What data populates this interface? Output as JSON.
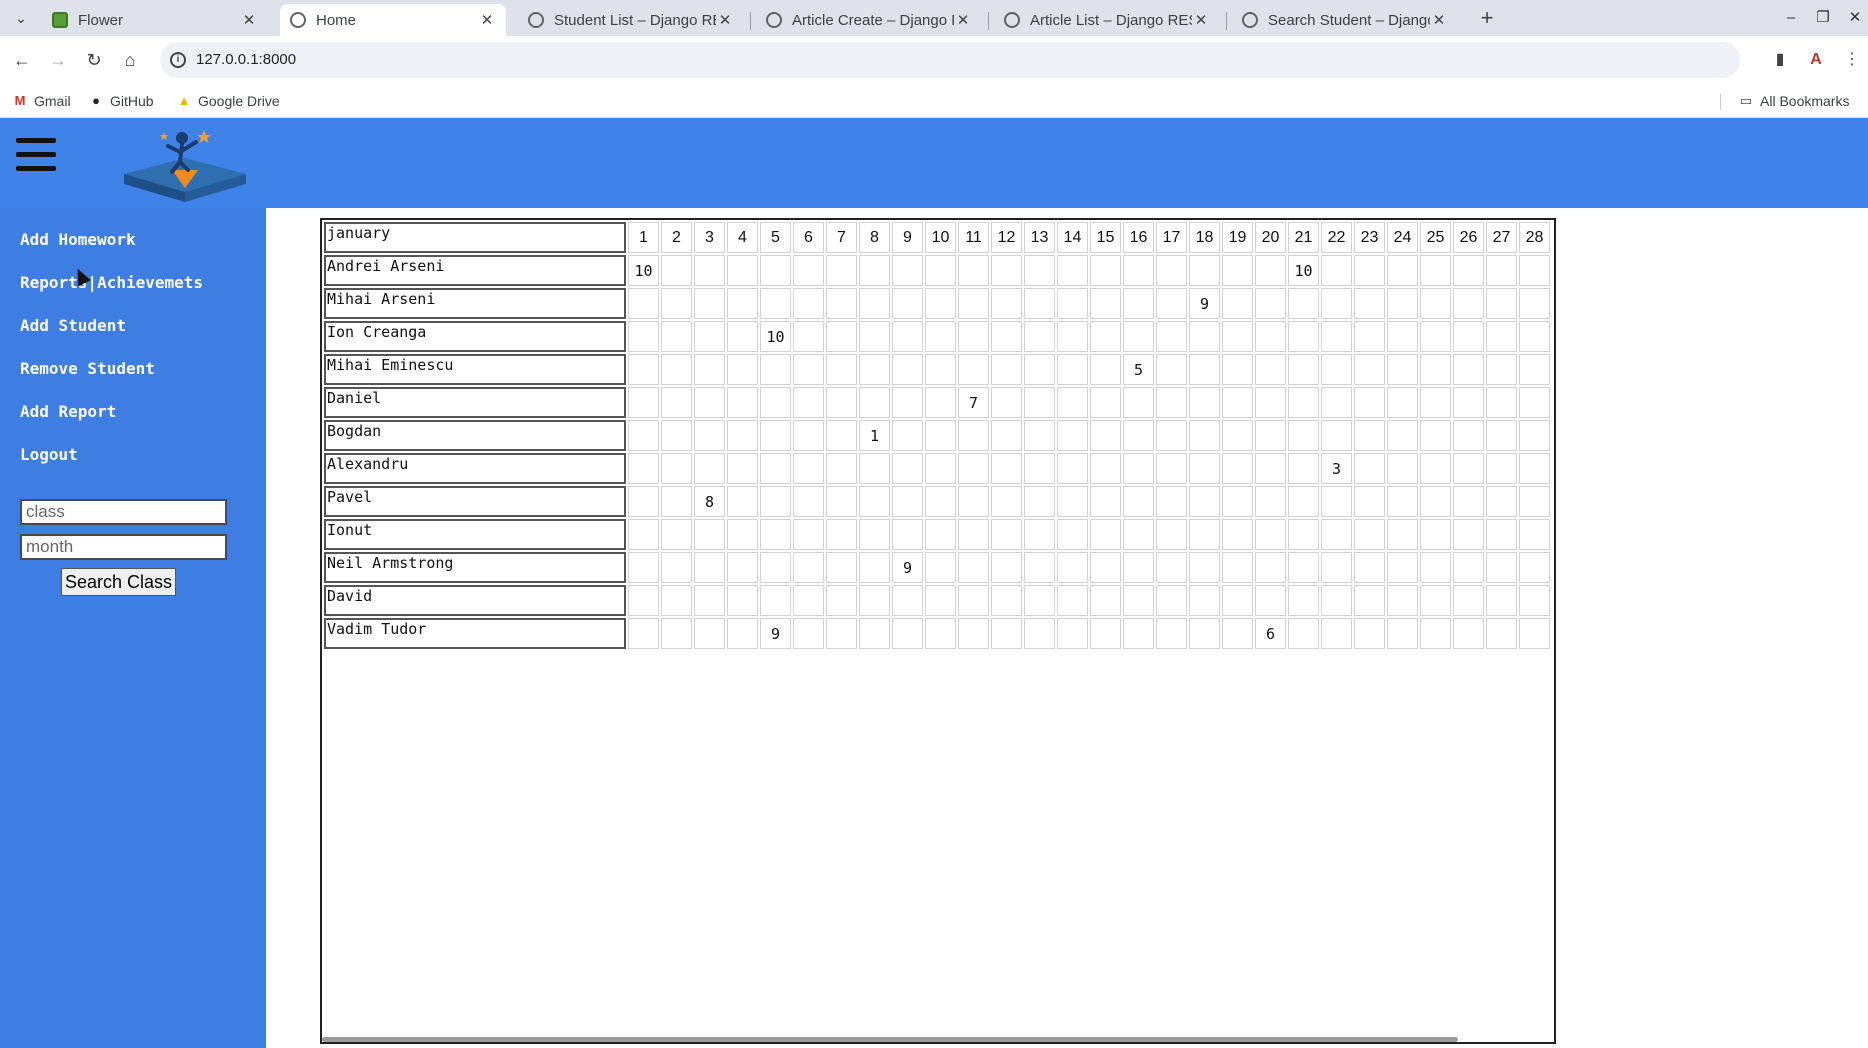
{
  "browser": {
    "tabs": [
      {
        "title": "Flower",
        "active": false,
        "icon": "flower-icon"
      },
      {
        "title": "Home",
        "active": true,
        "icon": "globe-icon"
      },
      {
        "title": "Student List – Django RE",
        "active": false,
        "icon": "globe-icon"
      },
      {
        "title": "Article Create – Django R",
        "active": false,
        "icon": "globe-icon"
      },
      {
        "title": "Article List – Django RES",
        "active": false,
        "icon": "globe-icon"
      },
      {
        "title": "Search Student – Django",
        "active": false,
        "icon": "globe-icon"
      }
    ],
    "url": "127.0.0.1:8000",
    "bookmarks": [
      {
        "label": "Gmail",
        "icon": "gmail-icon"
      },
      {
        "label": "GitHub",
        "icon": "github-icon"
      },
      {
        "label": "Google Drive",
        "icon": "drive-icon"
      }
    ],
    "all_bookmarks_label": "All Bookmarks"
  },
  "sidebar": {
    "links": [
      "Add Homework",
      "Reports|Achievemets",
      "Add Student",
      "Remove Student",
      "Add Report",
      "Logout"
    ],
    "class_placeholder": "class",
    "month_placeholder": "month",
    "search_button": "Search Class"
  },
  "grid": {
    "month": "january",
    "days": [
      "1",
      "2",
      "3",
      "4",
      "5",
      "6",
      "7",
      "8",
      "9",
      "10",
      "11",
      "12",
      "13",
      "14",
      "15",
      "16",
      "17",
      "18",
      "19",
      "20",
      "21",
      "22",
      "23",
      "24",
      "25",
      "26",
      "27",
      "28"
    ],
    "students": [
      {
        "name": "Andrei Arseni",
        "grades": {
          "1": "10",
          "21": "10"
        }
      },
      {
        "name": "Mihai Arseni",
        "grades": {
          "18": "9"
        }
      },
      {
        "name": "Ion Creanga",
        "grades": {
          "5": "10"
        }
      },
      {
        "name": "Mihai Eminescu",
        "grades": {
          "16": "5"
        }
      },
      {
        "name": "Daniel",
        "grades": {
          "11": "7"
        }
      },
      {
        "name": "Bogdan",
        "grades": {
          "8": "1"
        }
      },
      {
        "name": "Alexandru",
        "grades": {
          "22": "3"
        }
      },
      {
        "name": "Pavel",
        "grades": {
          "3": "8"
        }
      },
      {
        "name": "Ionut",
        "grades": {}
      },
      {
        "name": "Neil Armstrong",
        "grades": {
          "9": "9"
        }
      },
      {
        "name": "David",
        "grades": {}
      },
      {
        "name": "Vadim Tudor",
        "grades": {
          "5": "9",
          "20": "6"
        }
      }
    ]
  },
  "colors": {
    "header": "#3f83e8",
    "sidebar": "#3e7ee3"
  }
}
